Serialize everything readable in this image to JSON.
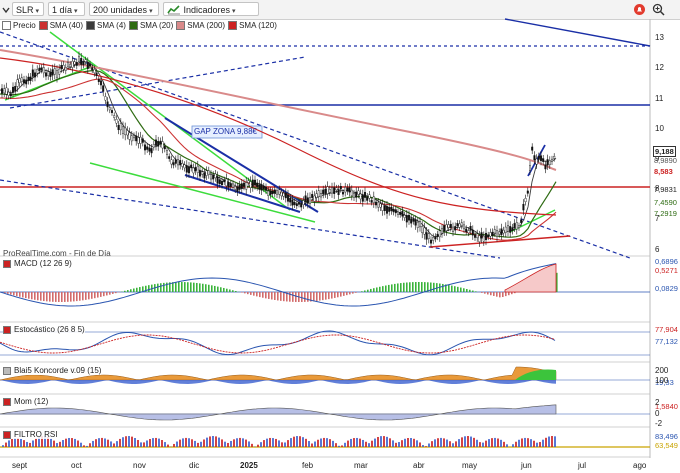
{
  "toolbar": {
    "symbol": "SLR",
    "interval": "1 día",
    "units": "200 unidades",
    "indicators": "Indicadores"
  },
  "legend": [
    {
      "label": "Precio",
      "color": "#ffffff"
    },
    {
      "label": "SMA (40)",
      "color": "#cc3333"
    },
    {
      "label": "SMA (4)",
      "color": "#3a3a3a"
    },
    {
      "label": "SMA (20)",
      "color": "#2e6b12"
    },
    {
      "label": "SMA (200)",
      "color": "#d98a8a"
    },
    {
      "label": "SMA (120)",
      "color": "#cc2222"
    }
  ],
  "annotation": "GAP ZONA 9,88€",
  "source": "ProRealTime.com - Fin de Día",
  "price_axis": {
    "ticks": [
      "13",
      "12",
      "11",
      "10",
      "9",
      "8",
      "7",
      "6"
    ],
    "tags": [
      {
        "text": "9,188",
        "bg": "#ffffff",
        "color": "#111111"
      },
      {
        "text": "8,9890",
        "bg": "#ffffff",
        "color": "#555555"
      },
      {
        "text": "8,583",
        "bg": "#ffffff",
        "color": "#cc2222"
      },
      {
        "text": "7,9831",
        "bg": "#ffffff",
        "color": "#111111"
      },
      {
        "text": "7,4590",
        "bg": "#ffffff",
        "color": "#2e6b12"
      },
      {
        "text": "7,2919",
        "bg": "#ffffff",
        "color": "#2e6b12"
      }
    ]
  },
  "panels": [
    {
      "key": "macd",
      "label": "MACD (12 26 9)",
      "tags": [
        "0,6896",
        "0,5271",
        "0,0829"
      ],
      "ticks": []
    },
    {
      "key": "stoch",
      "label": "Estocástico (26 8 5)",
      "tags": [
        "77,904",
        "77,132"
      ],
      "ticks": []
    },
    {
      "key": "blai",
      "label": "Blai5 Koncorde v.09 (15)",
      "tags": [
        "19,33"
      ],
      "ticks": [
        "200",
        "100"
      ]
    },
    {
      "key": "mom",
      "label": "Mom (12)",
      "tags": [
        "1,5840"
      ],
      "ticks": [
        "2",
        "0",
        "-2"
      ]
    },
    {
      "key": "rsi",
      "label": "FILTRO RSI",
      "tags": [
        "83,496",
        "63,549"
      ],
      "ticks": []
    }
  ],
  "time_axis": [
    "sept",
    "oct",
    "nov",
    "dic",
    "2025",
    "feb",
    "mar",
    "abr",
    "may",
    "jun",
    "jul",
    "ago"
  ],
  "colors": {
    "candle": "#111111",
    "sma200": "#d98a8a",
    "sma120": "#cc2222",
    "sma40": "#cc3333",
    "sma20": "#2e6b12",
    "trend_blue": "#1a2fa6",
    "channel_green": "#3cdc3c"
  },
  "icons": {
    "symbol_menu": "chevron-down-icon",
    "indicators": "indicator-chart-icon",
    "alert": "alert-bell-icon",
    "zoom": "zoom-in-icon",
    "panel_close": "close-icon"
  }
}
